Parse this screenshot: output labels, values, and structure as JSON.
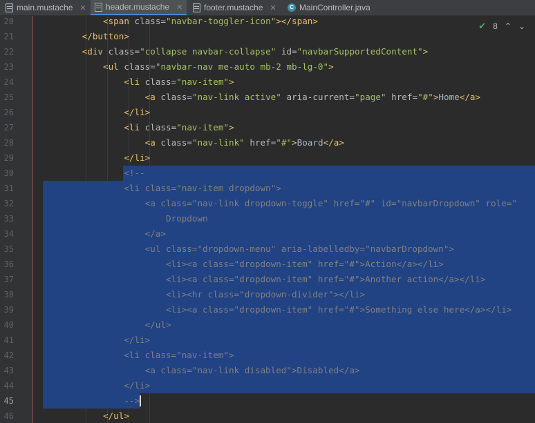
{
  "tabs": [
    {
      "label": "main.mustache",
      "icon": "file-icon",
      "active": false
    },
    {
      "label": "header.mustache",
      "icon": "file-icon",
      "active": true
    },
    {
      "label": "footer.mustache",
      "icon": "file-icon",
      "active": false
    },
    {
      "label": "MainController.java",
      "icon": "class-icon",
      "active": false
    }
  ],
  "class_icon_letter": "C",
  "inspection": {
    "count": "8",
    "up": "⌃",
    "down": "⌄"
  },
  "line_numbers": [
    "20",
    "21",
    "22",
    "23",
    "24",
    "25",
    "26",
    "27",
    "28",
    "29",
    "30",
    "31",
    "32",
    "33",
    "34",
    "35",
    "36",
    "37",
    "38",
    "39",
    "40",
    "41",
    "42",
    "43",
    "44",
    "45",
    "46"
  ],
  "current_line": "45",
  "code_lines": [
    "            <span class=\"navbar-toggler-icon\"></span>",
    "        </button>",
    "        <div class=\"collapse navbar-collapse\" id=\"navbarSupportedContent\">",
    "            <ul class=\"navbar-nav me-auto mb-2 mb-lg-0\">",
    "                <li class=\"nav-item\">",
    "                    <a class=\"nav-link active\" aria-current=\"page\" href=\"#\">Home</a>",
    "                </li>",
    "                <li class=\"nav-item\">",
    "                    <a class=\"nav-link\" href=\"#\">Board</a>",
    "                </li>",
    "                <!--",
    "                <li class=\"nav-item dropdown\">",
    "                    <a class=\"nav-link dropdown-toggle\" href=\"#\" id=\"navbarDropdown\" role=\"",
    "                        Dropdown",
    "                    </a>",
    "                    <ul class=\"dropdown-menu\" aria-labelledby=\"navbarDropdown\">",
    "                        <li><a class=\"dropdown-item\" href=\"#\">Action</a></li>",
    "                        <li><a class=\"dropdown-item\" href=\"#\">Another action</a></li>",
    "                        <li><hr class=\"dropdown-divider\"></li>",
    "                        <li><a class=\"dropdown-item\" href=\"#\">Something else here</a></li>",
    "                    </ul>",
    "                </li>",
    "                <li class=\"nav-item\">",
    "                    <a class=\"nav-link disabled\">Disabled</a>",
    "                </li>",
    "                -->",
    "            </ul>"
  ],
  "colors": {
    "selection": "#214283",
    "tag": "#e8bf6a",
    "value": "#a5c261",
    "comment": "#808080",
    "active_tab_underline": "#4a88c7"
  }
}
